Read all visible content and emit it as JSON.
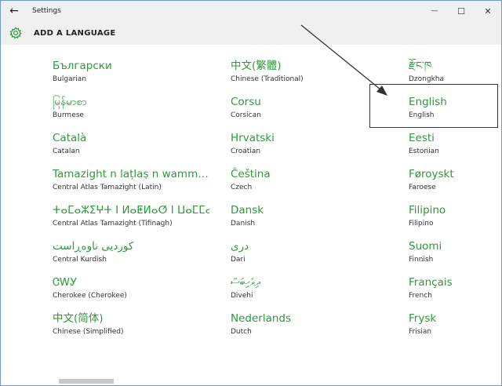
{
  "window": {
    "title": "Settings",
    "back_icon": "←",
    "minimize_icon": "—",
    "maximize_icon": "☐",
    "close_icon": "✕"
  },
  "header": {
    "title": "ADD A LANGUAGE"
  },
  "colors": {
    "accent": "#2b9a3a",
    "chrome": "#f0f0f0",
    "text": "#333333"
  },
  "languages": [
    {
      "native": "Български",
      "english": "Bulgarian"
    },
    {
      "native": "မြန်မာစာ",
      "english": "Burmese"
    },
    {
      "native": "Català",
      "english": "Catalan"
    },
    {
      "native": "Tamazight n laṭlaṣ n wamm…",
      "english": "Central Atlas Tamazight (Latin)"
    },
    {
      "native": "ⵜⴰⵎⴰⵣⵉⵖⵜ ⵏ ⵍⴰⵟⵍⴰⵚ ⵏ ⵡⴰⵎⵎⴰⵙ",
      "english": "Central Atlas Tamazight (Tifinagh)"
    },
    {
      "native": "کوردیی ناوەڕاست",
      "english": "Central Kurdish"
    },
    {
      "native": "ᏣᎳᎩ",
      "english": "Cherokee (Cherokee)"
    },
    {
      "native": "中文(简体)",
      "english": "Chinese (Simplified)"
    },
    {
      "native": "中文(繁體)",
      "english": "Chinese (Traditional)"
    },
    {
      "native": "Corsu",
      "english": "Corsican"
    },
    {
      "native": "Hrvatski",
      "english": "Croatian"
    },
    {
      "native": "Čeština",
      "english": "Czech"
    },
    {
      "native": "Dansk",
      "english": "Danish"
    },
    {
      "native": "دری",
      "english": "Dari"
    },
    {
      "native": "ދިވެހިބަސް",
      "english": "Divehi"
    },
    {
      "native": "Nederlands",
      "english": "Dutch"
    },
    {
      "native": "རྫོང་ཁ",
      "english": "Dzongkha"
    },
    {
      "native": "English",
      "english": "English"
    },
    {
      "native": "Eesti",
      "english": "Estonian"
    },
    {
      "native": "Føroyskt",
      "english": "Faroese"
    },
    {
      "native": "Filipino",
      "english": "Filipino"
    },
    {
      "native": "Suomi",
      "english": "Finnish"
    },
    {
      "native": "Français",
      "english": "French"
    },
    {
      "native": "Frysk",
      "english": "Frisian"
    }
  ]
}
